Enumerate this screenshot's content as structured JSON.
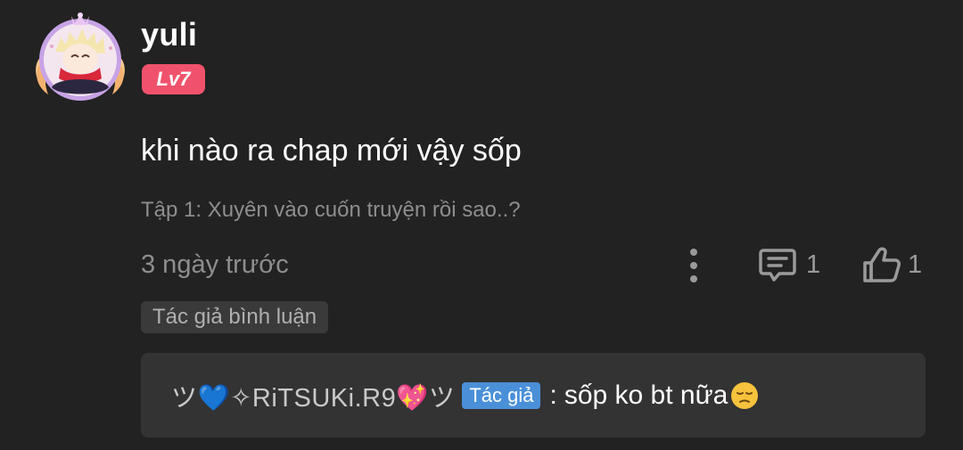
{
  "comment": {
    "username": "yuli",
    "level": "Lv7",
    "text": "khi nào ra chap mới vậy sốp",
    "chapter": "Tập 1: Xuyên vào cuốn truyện rồi sao..?",
    "time": "3 ngày trước",
    "reply_count": "1",
    "like_count": "1",
    "author_commented_tag": "Tác giả bình luận",
    "icons": {
      "avatar": "user-avatar",
      "more": "more-vertical-icon",
      "reply": "comment-icon",
      "like": "thumbs-up-icon"
    }
  },
  "reply": {
    "author": "ツ💙✧RiTSUKi.R9💖ツ",
    "author_badge": "Tác giả",
    "separator": ":",
    "text": "sốp ko bt nữa",
    "emoji": "pensive-face-emoji"
  },
  "colors": {
    "background": "#222222",
    "level_badge": "#f0526c",
    "author_badge": "#4a90d9",
    "reply_box": "#333333",
    "muted_text": "#8e8e8e"
  }
}
